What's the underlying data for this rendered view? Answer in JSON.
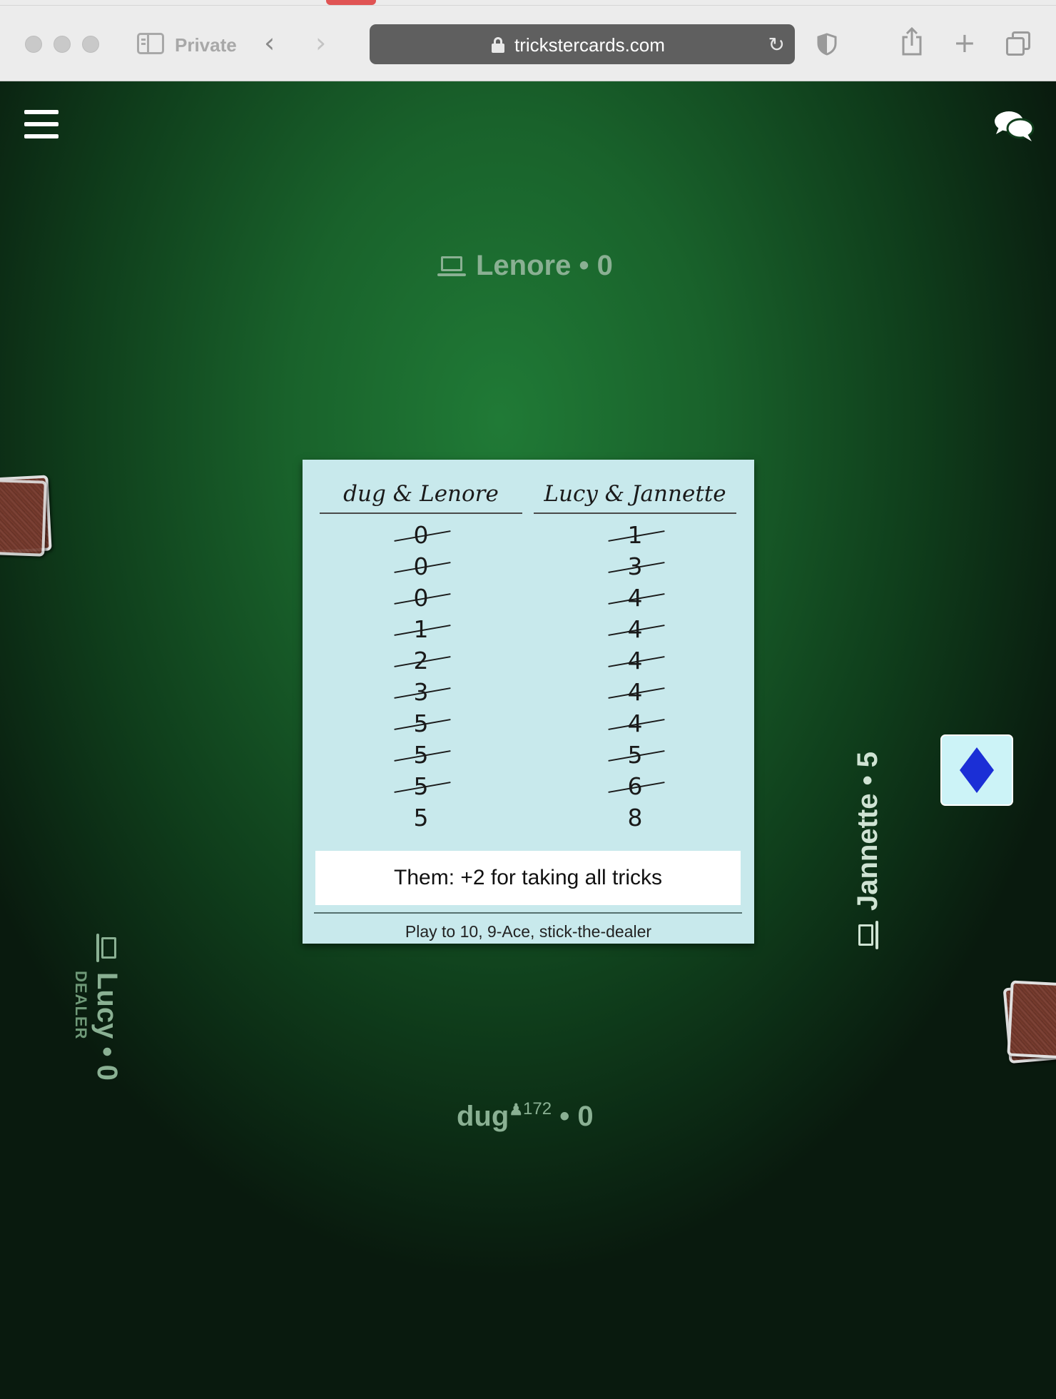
{
  "browser": {
    "private_label": "Private",
    "url": "trickstercards.com"
  },
  "players": {
    "top": {
      "name_score": "Lenore • 0"
    },
    "bottom": {
      "name": "dug",
      "rating": "172",
      "score_suffix": "• 0"
    },
    "left": {
      "name_score": "Lucy • 0",
      "role": "DEALER"
    },
    "right": {
      "name_score": "Jannette • 5"
    }
  },
  "trump": {
    "suit": "diamonds",
    "symbol": "♦",
    "color": "#1b2fd6"
  },
  "scoresheet": {
    "team_a": "dug & Lenore",
    "team_b": "Lucy & Jannette",
    "team_a_scores": [
      {
        "v": "0",
        "crossed": true
      },
      {
        "v": "0",
        "crossed": true
      },
      {
        "v": "0",
        "crossed": true
      },
      {
        "v": "1",
        "crossed": true
      },
      {
        "v": "2",
        "crossed": true
      },
      {
        "v": "3",
        "crossed": true
      },
      {
        "v": "5",
        "crossed": true
      },
      {
        "v": "5",
        "crossed": true
      },
      {
        "v": "5",
        "crossed": true
      },
      {
        "v": "5",
        "crossed": false
      }
    ],
    "team_b_scores": [
      {
        "v": "1",
        "crossed": true
      },
      {
        "v": "3",
        "crossed": true
      },
      {
        "v": "4",
        "crossed": true
      },
      {
        "v": "4",
        "crossed": true
      },
      {
        "v": "4",
        "crossed": true
      },
      {
        "v": "4",
        "crossed": true
      },
      {
        "v": "4",
        "crossed": true
      },
      {
        "v": "5",
        "crossed": true
      },
      {
        "v": "6",
        "crossed": true
      },
      {
        "v": "8",
        "crossed": false
      }
    ],
    "message": "Them: +2 for taking all tricks",
    "rules": "Play to 10, 9-Ace, stick-the-dealer"
  },
  "colors": {
    "felt": "#1f7a36",
    "scoresheet_bg": "#c8e9ec",
    "trump_card_bg": "#ccf3f7"
  }
}
